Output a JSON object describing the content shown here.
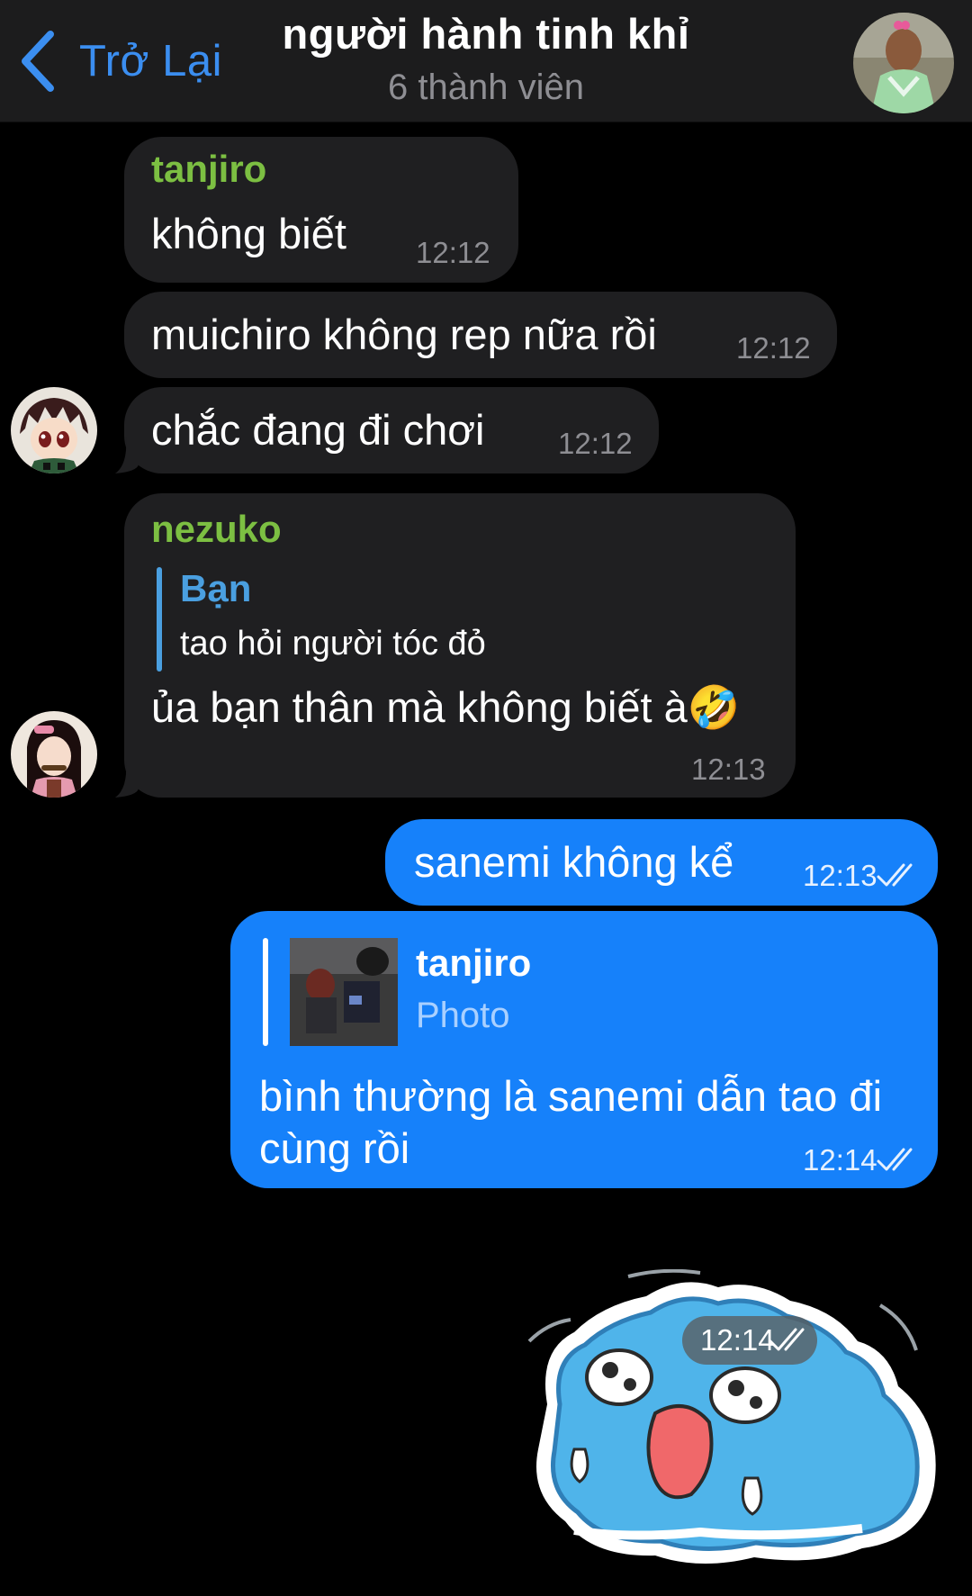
{
  "header": {
    "back_label": "Trở Lại",
    "title": "người hành tinh khỉ",
    "subtitle": "6 thành viên"
  },
  "messages": [
    {
      "sender": "tanjiro",
      "text": "không biết",
      "time": "12:12"
    },
    {
      "text": "muichiro không rep nữa rồi",
      "time": "12:12"
    },
    {
      "text": "chắc đang đi chơi",
      "time": "12:12"
    },
    {
      "sender": "nezuko",
      "reply_to": {
        "name": "Bạn",
        "text": "tao hỏi người tóc đỏ"
      },
      "text": "ủa bạn thân mà không biết à🤣",
      "time": "12:13"
    },
    {
      "text": "sanemi không kể",
      "time": "12:13"
    },
    {
      "reply_to": {
        "name": "tanjiro",
        "text": "Photo"
      },
      "text_line1": "bình thường là sanemi dẫn tao đi",
      "text_line2": "cùng rồi",
      "time": "12:14"
    },
    {
      "sticker": "crying-blue-cat-sticker",
      "time": "12:14"
    }
  ],
  "colors": {
    "background": "#000000",
    "header": "#1c1c1d",
    "incoming_bubble": "#1f1f21",
    "outgoing_bubble": "#1681fa",
    "accent": "#3b8ef0",
    "sender_name": "#7cbf42"
  }
}
